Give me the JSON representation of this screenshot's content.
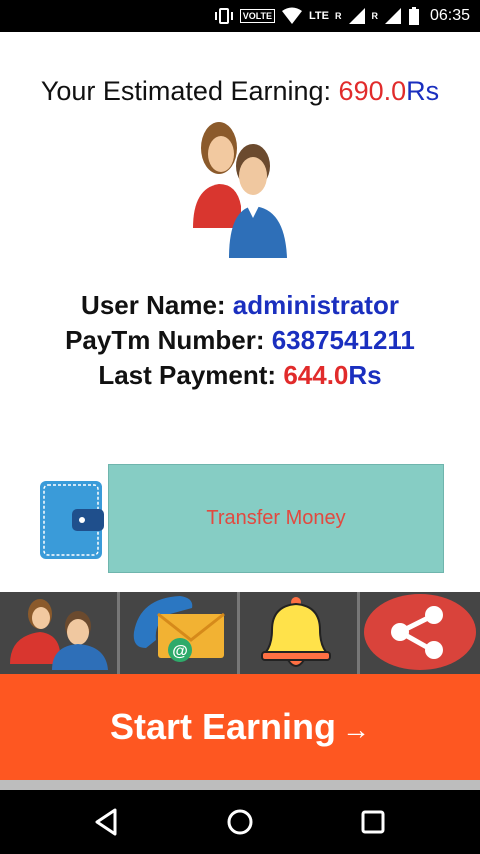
{
  "status_bar": {
    "volte": "VOLTE",
    "lte": "LTE",
    "roaming_1": "R",
    "roaming_2": "R",
    "time": "06:35"
  },
  "earning": {
    "label": "Your Estimated Earning:",
    "value": "690.0",
    "unit": "Rs"
  },
  "user": {
    "name_label": "User Name:",
    "name_value": "administrator",
    "paytm_label": "PayTm Number:",
    "paytm_value": "6387541211",
    "last_payment_label": "Last Payment:",
    "last_payment_value": "644.0",
    "last_payment_unit": "Rs"
  },
  "transfer": {
    "label": "Transfer Money"
  },
  "tabs": [
    {
      "icon": "users-icon"
    },
    {
      "icon": "contact-mail-icon"
    },
    {
      "icon": "bell-icon"
    },
    {
      "icon": "share-icon"
    }
  ],
  "start_button": {
    "label": "Start Earning",
    "arrow": "→"
  },
  "colors": {
    "accent_orange": "#fe5721",
    "transfer_bg": "#86cdc4",
    "value_red": "#e12b2b",
    "value_blue": "#1a2fbf"
  }
}
